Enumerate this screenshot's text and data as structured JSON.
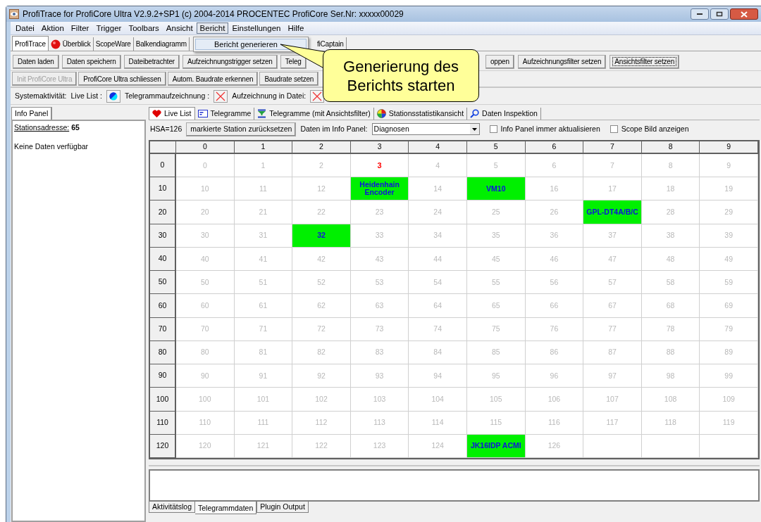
{
  "window": {
    "title": "ProfiTrace for ProfiCore Ultra V2.9.2+SP1 (c) 2004-2014 PROCENTEC  ProfiCore Ser.Nr: xxxxx00029"
  },
  "menu_bar": [
    {
      "label": "Datei",
      "selected": false
    },
    {
      "label": "Aktion",
      "selected": false
    },
    {
      "label": "Filter",
      "selected": false
    },
    {
      "label": "Trigger",
      "selected": false
    },
    {
      "label": "Toolbars",
      "selected": false
    },
    {
      "label": "Ansicht",
      "selected": false
    },
    {
      "label": "Bericht",
      "selected": true
    },
    {
      "label": "Einstellungen",
      "selected": false
    },
    {
      "label": "Hilfe",
      "selected": false
    }
  ],
  "open_menu": {
    "items": [
      {
        "label": "Bericht generieren",
        "selected": true
      }
    ]
  },
  "main_tabs": [
    {
      "label": "ProfiTrace",
      "selected": true,
      "kind": "plain"
    },
    {
      "label": "Überblick",
      "selected": false,
      "kind": "icon"
    },
    {
      "label": "ScopeWare",
      "selected": false,
      "kind": "plain"
    },
    {
      "label": "Balkendiagramm",
      "selected": false,
      "kind": "plain"
    },
    {
      "label": "fiCaptain",
      "selected": false,
      "kind": "plain"
    }
  ],
  "toolbar_1": [
    {
      "label": "Daten laden",
      "disabled": false,
      "focused": false
    },
    {
      "label": "Daten speichern",
      "disabled": false,
      "focused": false
    },
    {
      "label": "Dateibetrachter",
      "disabled": false,
      "focused": false
    },
    {
      "label": "Aufzeichnungstrigger setzen",
      "disabled": false,
      "focused": false
    },
    {
      "label": "Teleg",
      "disabled": false,
      "focused": false
    },
    {
      "label": "oppen",
      "disabled": false,
      "focused": false
    },
    {
      "label": "Aufzeichnungsfilter setzen",
      "disabled": false,
      "focused": false
    },
    {
      "label": "Ansichtsfilter setzen",
      "disabled": false,
      "focused": true
    }
  ],
  "toolbar_2": [
    {
      "label": "Init ProfiCore Ultra",
      "disabled": true,
      "focused": false
    },
    {
      "label": "ProfiCore Ultra schliessen",
      "disabled": false,
      "focused": false
    },
    {
      "label": "Autom. Baudrate erkennen",
      "disabled": false,
      "focused": false
    },
    {
      "label": "Baudrate setzen",
      "disabled": false,
      "focused": false
    }
  ],
  "callout": {
    "lines": [
      "Generierung des",
      "Berichts starten"
    ]
  },
  "activity": {
    "label": "Systemaktivität:",
    "indicators": [
      {
        "label": "Live List :",
        "kind": "running"
      },
      {
        "label": "Telegrammaufzeichnung :",
        "kind": "stopped"
      },
      {
        "label": "Aufzeichnung in Datei:",
        "kind": "stopped"
      }
    ]
  },
  "info_panel": {
    "tab": "Info Panel",
    "address_label": "Stationsadresse:",
    "address_value": "65",
    "message": "Keine Daten verfügbar"
  },
  "view_tabs": [
    {
      "label": "Live List",
      "selected": true,
      "kind": "heart"
    },
    {
      "label": "Telegramme",
      "selected": false,
      "kind": "telegram"
    },
    {
      "label": "Telegramme (mit Ansichtsfilter)",
      "selected": false,
      "kind": "filter"
    },
    {
      "label": "Stationsstatistikansicht",
      "selected": false,
      "kind": "stats"
    },
    {
      "label": "Daten Inspektion",
      "selected": false,
      "kind": "inspect"
    }
  ],
  "live_list": {
    "hsa": "HSA=126",
    "reset_button": "markierte Station zurücksetzen",
    "info_label": "Daten im Info Panel:",
    "info_select": "Diagnosen",
    "checkboxes": [
      {
        "label": "Info Panel immer aktualisieren",
        "checked": false
      },
      {
        "label": "Scope Bild anzeigen",
        "checked": false
      }
    ],
    "columns": [
      "0",
      "1",
      "2",
      "3",
      "4",
      "5",
      "6",
      "7",
      "8",
      "9"
    ],
    "rows": [
      {
        "label": "0",
        "cells": [
          {
            "text": "0",
            "kind": "free"
          },
          {
            "text": "1",
            "kind": "free"
          },
          {
            "text": "2",
            "kind": "free"
          },
          {
            "text": "3",
            "kind": "marked"
          },
          {
            "text": "4",
            "kind": "free"
          },
          {
            "text": "5",
            "kind": "free"
          },
          {
            "text": "6",
            "kind": "free"
          },
          {
            "text": "7",
            "kind": "free"
          },
          {
            "text": "8",
            "kind": "free"
          },
          {
            "text": "9",
            "kind": "free"
          }
        ]
      },
      {
        "label": "10",
        "cells": [
          {
            "text": "10",
            "kind": "free"
          },
          {
            "text": "11",
            "kind": "free"
          },
          {
            "text": "12",
            "kind": "free"
          },
          {
            "text": "Heidenhain Encoder",
            "kind": "live"
          },
          {
            "text": "14",
            "kind": "free"
          },
          {
            "text": "VM10",
            "kind": "live"
          },
          {
            "text": "16",
            "kind": "free"
          },
          {
            "text": "17",
            "kind": "free"
          },
          {
            "text": "18",
            "kind": "free"
          },
          {
            "text": "19",
            "kind": "free"
          }
        ]
      },
      {
        "label": "20",
        "cells": [
          {
            "text": "20",
            "kind": "free"
          },
          {
            "text": "21",
            "kind": "free"
          },
          {
            "text": "22",
            "kind": "free"
          },
          {
            "text": "23",
            "kind": "free"
          },
          {
            "text": "24",
            "kind": "free"
          },
          {
            "text": "25",
            "kind": "free"
          },
          {
            "text": "26",
            "kind": "free"
          },
          {
            "text": "GPL-DT4A/B/C",
            "kind": "live"
          },
          {
            "text": "28",
            "kind": "free"
          },
          {
            "text": "29",
            "kind": "free"
          }
        ]
      },
      {
        "label": "30",
        "cells": [
          {
            "text": "30",
            "kind": "free"
          },
          {
            "text": "31",
            "kind": "free"
          },
          {
            "text": "32",
            "kind": "live"
          },
          {
            "text": "33",
            "kind": "free"
          },
          {
            "text": "34",
            "kind": "free"
          },
          {
            "text": "35",
            "kind": "free"
          },
          {
            "text": "36",
            "kind": "free"
          },
          {
            "text": "37",
            "kind": "free"
          },
          {
            "text": "38",
            "kind": "free"
          },
          {
            "text": "39",
            "kind": "free"
          }
        ]
      },
      {
        "label": "40",
        "cells": [
          {
            "text": "40",
            "kind": "free"
          },
          {
            "text": "41",
            "kind": "free"
          },
          {
            "text": "42",
            "kind": "free"
          },
          {
            "text": "43",
            "kind": "free"
          },
          {
            "text": "44",
            "kind": "free"
          },
          {
            "text": "45",
            "kind": "free"
          },
          {
            "text": "46",
            "kind": "free"
          },
          {
            "text": "47",
            "kind": "free"
          },
          {
            "text": "48",
            "kind": "free"
          },
          {
            "text": "49",
            "kind": "free"
          }
        ]
      },
      {
        "label": "50",
        "cells": [
          {
            "text": "50",
            "kind": "free"
          },
          {
            "text": "51",
            "kind": "free"
          },
          {
            "text": "52",
            "kind": "free"
          },
          {
            "text": "53",
            "kind": "free"
          },
          {
            "text": "54",
            "kind": "free"
          },
          {
            "text": "55",
            "kind": "free"
          },
          {
            "text": "56",
            "kind": "free"
          },
          {
            "text": "57",
            "kind": "free"
          },
          {
            "text": "58",
            "kind": "free"
          },
          {
            "text": "59",
            "kind": "free"
          }
        ]
      },
      {
        "label": "60",
        "cells": [
          {
            "text": "60",
            "kind": "free"
          },
          {
            "text": "61",
            "kind": "free"
          },
          {
            "text": "62",
            "kind": "free"
          },
          {
            "text": "63",
            "kind": "free"
          },
          {
            "text": "64",
            "kind": "free"
          },
          {
            "text": "65",
            "kind": "free"
          },
          {
            "text": "66",
            "kind": "free"
          },
          {
            "text": "67",
            "kind": "free"
          },
          {
            "text": "68",
            "kind": "free"
          },
          {
            "text": "69",
            "kind": "free"
          }
        ]
      },
      {
        "label": "70",
        "cells": [
          {
            "text": "70",
            "kind": "free"
          },
          {
            "text": "71",
            "kind": "free"
          },
          {
            "text": "72",
            "kind": "free"
          },
          {
            "text": "73",
            "kind": "free"
          },
          {
            "text": "74",
            "kind": "free"
          },
          {
            "text": "75",
            "kind": "free"
          },
          {
            "text": "76",
            "kind": "free"
          },
          {
            "text": "77",
            "kind": "free"
          },
          {
            "text": "78",
            "kind": "free"
          },
          {
            "text": "79",
            "kind": "free"
          }
        ]
      },
      {
        "label": "80",
        "cells": [
          {
            "text": "80",
            "kind": "free"
          },
          {
            "text": "81",
            "kind": "free"
          },
          {
            "text": "82",
            "kind": "free"
          },
          {
            "text": "83",
            "kind": "free"
          },
          {
            "text": "84",
            "kind": "free"
          },
          {
            "text": "85",
            "kind": "free"
          },
          {
            "text": "86",
            "kind": "free"
          },
          {
            "text": "87",
            "kind": "free"
          },
          {
            "text": "88",
            "kind": "free"
          },
          {
            "text": "89",
            "kind": "free"
          }
        ]
      },
      {
        "label": "90",
        "cells": [
          {
            "text": "90",
            "kind": "free"
          },
          {
            "text": "91",
            "kind": "free"
          },
          {
            "text": "92",
            "kind": "free"
          },
          {
            "text": "93",
            "kind": "free"
          },
          {
            "text": "94",
            "kind": "free"
          },
          {
            "text": "95",
            "kind": "free"
          },
          {
            "text": "96",
            "kind": "free"
          },
          {
            "text": "97",
            "kind": "free"
          },
          {
            "text": "98",
            "kind": "free"
          },
          {
            "text": "99",
            "kind": "free"
          }
        ]
      },
      {
        "label": "100",
        "cells": [
          {
            "text": "100",
            "kind": "free"
          },
          {
            "text": "101",
            "kind": "free"
          },
          {
            "text": "102",
            "kind": "free"
          },
          {
            "text": "103",
            "kind": "free"
          },
          {
            "text": "104",
            "kind": "free"
          },
          {
            "text": "105",
            "kind": "free"
          },
          {
            "text": "106",
            "kind": "free"
          },
          {
            "text": "107",
            "kind": "free"
          },
          {
            "text": "108",
            "kind": "free"
          },
          {
            "text": "109",
            "kind": "free"
          }
        ]
      },
      {
        "label": "110",
        "cells": [
          {
            "text": "110",
            "kind": "free"
          },
          {
            "text": "111",
            "kind": "free"
          },
          {
            "text": "112",
            "kind": "free"
          },
          {
            "text": "113",
            "kind": "free"
          },
          {
            "text": "114",
            "kind": "free"
          },
          {
            "text": "115",
            "kind": "free"
          },
          {
            "text": "116",
            "kind": "free"
          },
          {
            "text": "117",
            "kind": "free"
          },
          {
            "text": "118",
            "kind": "free"
          },
          {
            "text": "119",
            "kind": "free"
          }
        ]
      },
      {
        "label": "120",
        "cells": [
          {
            "text": "120",
            "kind": "free"
          },
          {
            "text": "121",
            "kind": "free"
          },
          {
            "text": "122",
            "kind": "free"
          },
          {
            "text": "123",
            "kind": "free"
          },
          {
            "text": "124",
            "kind": "free"
          },
          {
            "text": "JK16IDP ACMI",
            "kind": "live"
          },
          {
            "text": "126",
            "kind": "free"
          }
        ]
      }
    ]
  },
  "bottom_tabs": [
    {
      "label": "Aktivitätslog",
      "selected": false
    },
    {
      "label": "Telegrammdaten",
      "selected": true
    },
    {
      "label": "Plugin Output",
      "selected": false
    }
  ]
}
